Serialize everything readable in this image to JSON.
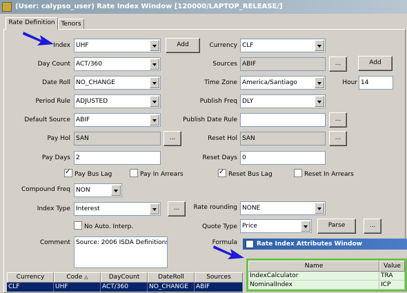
{
  "window": {
    "title": "(User: calypso_user) Rate Index Window [120000/LAPTOP_RELEASE/]",
    "tabs": [
      {
        "label": "Rate Definition"
      },
      {
        "label": "Tenors"
      }
    ]
  },
  "form": {
    "index": {
      "label": "Index",
      "value": "UHF",
      "add_label": "Add"
    },
    "currency": {
      "label": "Currency",
      "value": "CLF"
    },
    "day_count": {
      "label": "Day Count",
      "value": "ACT/360"
    },
    "sources": {
      "label": "Sources",
      "value": "ABIF",
      "ellipsis": "...",
      "add_label": "Add"
    },
    "date_roll": {
      "label": "Date Roll",
      "value": "NO_CHANGE"
    },
    "time_zone": {
      "label": "Time Zone",
      "value": "America/Santiago"
    },
    "hour": {
      "label": "Hour",
      "value": "14"
    },
    "period_rule": {
      "label": "Period Rule",
      "value": "ADJUSTED"
    },
    "publish_freq": {
      "label": "Publish Freq",
      "value": "DLY"
    },
    "default_source": {
      "label": "Default Source",
      "value": "ABIF"
    },
    "publish_date_rule": {
      "label": "Publish Date Rule",
      "value": "",
      "ellipsis": "..."
    },
    "pay_hol": {
      "label": "Pay Hol",
      "value": "SAN",
      "ellipsis": "..."
    },
    "reset_hol": {
      "label": "Reset Hol",
      "value": "SAN",
      "ellipsis": "..."
    },
    "pay_days": {
      "label": "Pay Days",
      "value": "2"
    },
    "reset_days": {
      "label": "Reset Days",
      "value": "0"
    },
    "pay_bus_lag": {
      "label": "Pay Bus Lag",
      "checked": true
    },
    "pay_in_arrears": {
      "label": "Pay In Arrears",
      "checked": false
    },
    "reset_bus_lag": {
      "label": "Reset Bus Lag",
      "checked": true
    },
    "reset_in_arrears": {
      "label": "Reset In Arrears",
      "checked": false
    },
    "compound_freq": {
      "label": "Compound Freq",
      "value": "NON"
    },
    "index_type": {
      "label": "Index Type",
      "value": "Interest",
      "ellipsis": "..."
    },
    "rate_rounding": {
      "label": "Rate rounding",
      "value": "NONE"
    },
    "no_auto_interp": {
      "label": "No Auto. Interp.",
      "checked": false
    },
    "quote_type": {
      "label": "Quote Type",
      "value": "Price",
      "parse_label": "Parse",
      "ellipsis": "..."
    },
    "comment": {
      "label": "Comment",
      "value": "Source: 2006 ISDA Definitions"
    },
    "formula": {
      "label": "Formula"
    }
  },
  "grid": {
    "columns": [
      "Currency",
      "Code",
      "DayCount",
      "DateRoll",
      "Sources"
    ],
    "sort_marker": "△",
    "rows": [
      [
        "CLF",
        "UHF",
        "ACT/360",
        "NO_CHANGE",
        "ABIF"
      ]
    ]
  },
  "attributes_window": {
    "title": "Rate Index Attributes Window",
    "columns": [
      "Name",
      "Value"
    ],
    "rows": [
      [
        "IndexCalculator",
        "TRA"
      ],
      [
        "NominalIndex",
        "ICP"
      ]
    ]
  },
  "colors": {
    "arrow": "#1a1ad8",
    "selected_row": "#0a246a",
    "attr_highlight": "#6abf4b"
  }
}
